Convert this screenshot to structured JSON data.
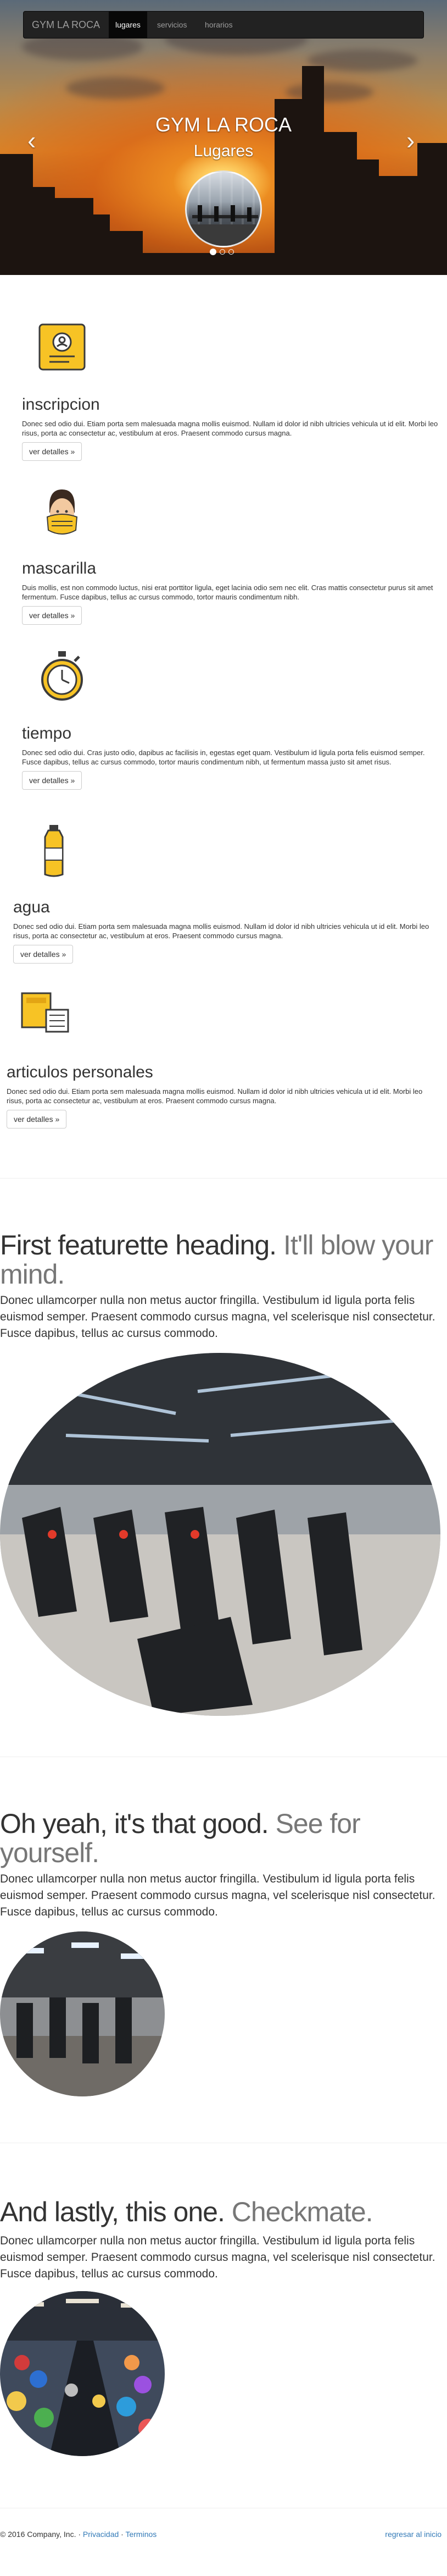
{
  "navbar": {
    "brand": "GYM LA ROCA",
    "links": [
      "lugares",
      "servicios",
      "horarios"
    ]
  },
  "carousel": {
    "title": "GYM LA ROCA",
    "subtitle": "Lugares",
    "prev_icon": "chevron-left-icon",
    "next_icon": "chevron-right-icon",
    "prev_glyph": "‹",
    "next_glyph": "›",
    "slide_count": 3,
    "active_slide": 1
  },
  "items": [
    {
      "title": "inscripcion",
      "text": "Donec sed odio dui. Etiam porta sem malesuada magna mollis euismod. Nullam id dolor id nibh ultricies vehicula ut id elit. Morbi leo risus, porta ac consectetur ac, vestibulum at eros. Praesent commodo cursus magna.",
      "button": "ver detalles »",
      "icon": "id-card-icon"
    },
    {
      "title": "mascarilla",
      "text": "Duis mollis, est non commodo luctus, nisi erat porttitor ligula, eget lacinia odio sem nec elit. Cras mattis consectetur purus sit amet fermentum. Fusce dapibus, tellus ac cursus commodo, tortor mauris condimentum nibh.",
      "button": "ver detalles »",
      "icon": "face-mask-icon"
    },
    {
      "title": "tiempo",
      "text": "Donec sed odio dui. Cras justo odio, dapibus ac facilisis in, egestas eget quam. Vestibulum id ligula porta felis euismod semper. Fusce dapibus, tellus ac cursus commodo, tortor mauris condimentum nibh, ut fermentum massa justo sit amet risus.",
      "button": "ver detalles »",
      "icon": "stopwatch-icon"
    },
    {
      "title": "agua",
      "text": "Donec sed odio dui. Etiam porta sem malesuada magna mollis euismod. Nullam id dolor id nibh ultricies vehicula ut id elit. Morbi leo risus, porta ac consectetur ac, vestibulum at eros. Praesent commodo cursus magna.",
      "button": "ver detalles »",
      "icon": "water-bottle-icon"
    },
    {
      "title": "articulos personales",
      "text": "Donec sed odio dui. Etiam porta sem malesuada magna mollis euismod. Nullam id dolor id nibh ultricies vehicula ut id elit. Morbi leo risus, porta ac consectetur ac, vestibulum at eros. Praesent commodo cursus magna.",
      "button": "ver detalles »",
      "icon": "towel-icon"
    }
  ],
  "featurettes": [
    {
      "heading": "First featurette heading.",
      "muted": "It'll blow your mind.",
      "text": "Donec ullamcorper nulla non metus auctor fringilla. Vestibulum id ligula porta felis euismod semper. Praesent commodo cursus magna, vel scelerisque nisl consectetur. Fusce dapibus, tellus ac cursus commodo.",
      "image": "gym-bikes-image"
    },
    {
      "heading": "Oh yeah, it's that good.",
      "muted": "See for yourself.",
      "text": "Donec ullamcorper nulla non metus auctor fringilla. Vestibulum id ligula porta felis euismod semper. Praesent commodo cursus magna, vel scelerisque nisl consectetur. Fusce dapibus, tellus ac cursus commodo.",
      "image": "gym-floor-image"
    },
    {
      "heading": "And lastly, this one.",
      "muted": "Checkmate.",
      "text": "Donec ullamcorper nulla non metus auctor fringilla. Vestibulum id ligula porta felis euismod semper. Praesent commodo cursus magna, vel scelerisque nisl consectetur. Fusce dapibus, tellus ac cursus commodo.",
      "image": "gym-crowd-image"
    }
  ],
  "footer": {
    "copyright": "© 2016 Company, Inc. ·",
    "privacy": "Privacidad",
    "dot": "·",
    "terms": "Terminos",
    "back": "regresar al inicio"
  },
  "colors": {
    "navbar_bg": "#222222",
    "link": "#337ab7",
    "icon_yellow": "#f7c325",
    "icon_outline": "#3b3b3b",
    "muted": "#777777"
  }
}
